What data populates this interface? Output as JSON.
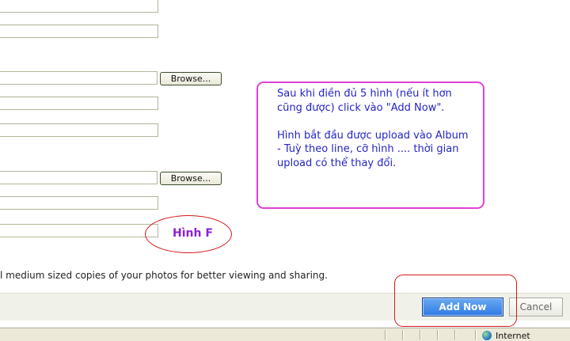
{
  "form": {
    "browse_label": "Browse...",
    "note": "l medium sized copies of your photos for better viewing and sharing."
  },
  "callout": {
    "paragraph1": "Sau khi điền đủ 5 hình (nếu ít hơn cũng được) click vào \"Add Now\".",
    "paragraph2": "Hình bắt đầu được upload vào Album - Tuỳ theo line, cỡ hình .... thời gian upload có thể thay đổi."
  },
  "annotation": {
    "label": "Hình F"
  },
  "actions": {
    "add_now": "Add Now",
    "cancel": "Cancel"
  },
  "status": {
    "zone": "Internet"
  }
}
